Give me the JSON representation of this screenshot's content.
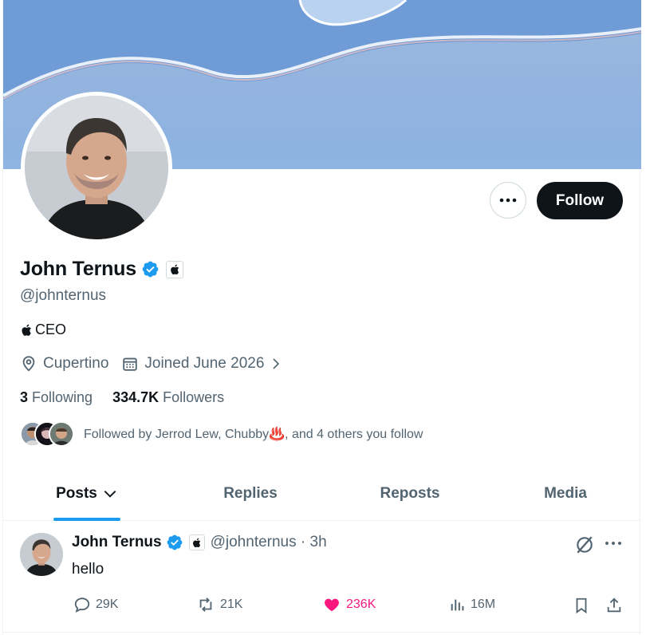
{
  "profile": {
    "display_name": "John Ternus",
    "handle": "@johnternus",
    "bio": "CEO",
    "location": "Cupertino",
    "joined": "Joined June 2026",
    "following_count": "3",
    "following_label": "Following",
    "followers_count": "334.7K",
    "followers_label": "Followers",
    "followed_by": "Followed by Jerrod Lew, Chubby♨️, and 4 others you follow"
  },
  "buttons": {
    "follow_label": "Follow"
  },
  "tabs": [
    {
      "label": "Posts",
      "active": true
    },
    {
      "label": "Replies",
      "active": false
    },
    {
      "label": "Reposts",
      "active": false
    },
    {
      "label": "Media",
      "active": false
    }
  ],
  "post": {
    "author_name": "John Ternus",
    "author_handle": "@johnternus · 3h",
    "text": "hello",
    "replies": "29K",
    "reposts": "21K",
    "likes": "236K",
    "views": "16M",
    "liked": true
  },
  "colors": {
    "accent": "#1d9bf0",
    "like": "#f91880",
    "primary_button": "#0f1419"
  }
}
